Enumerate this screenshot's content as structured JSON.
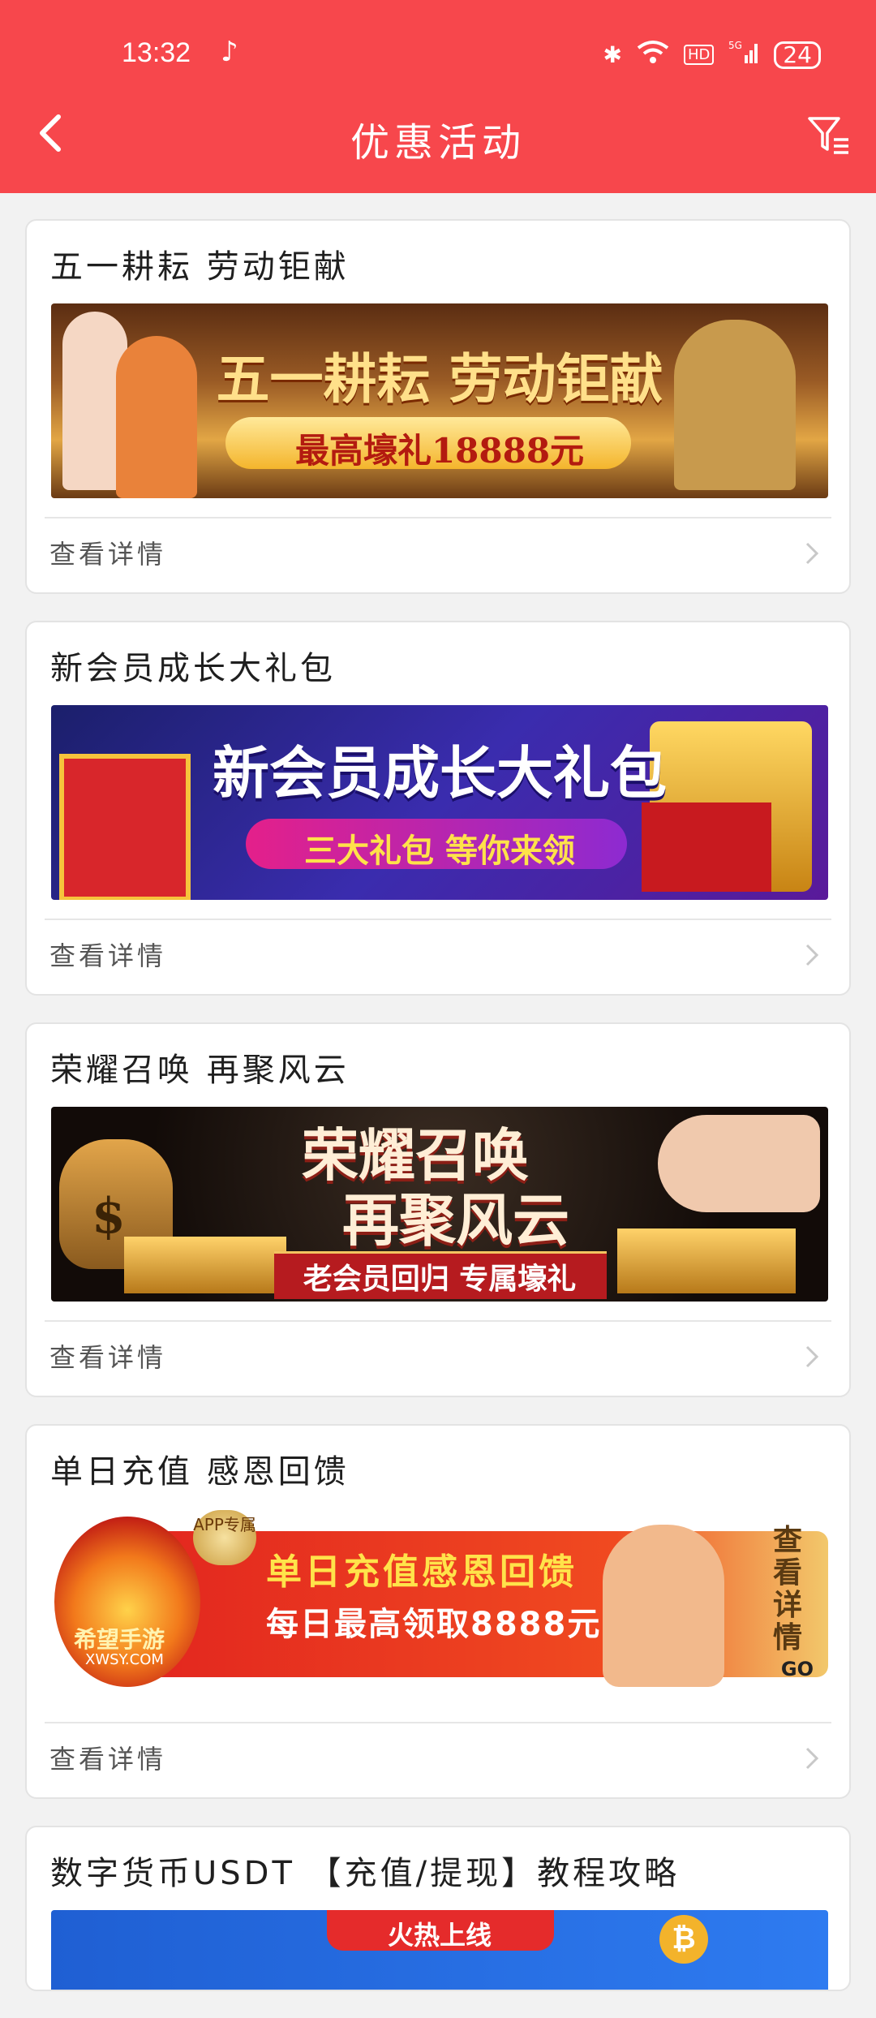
{
  "status_bar": {
    "time": "13:32",
    "battery": "24"
  },
  "header": {
    "title": "优惠活动"
  },
  "cards": [
    {
      "title": "五一耕耘 劳动钜献",
      "banner_line1": "五一耕耘 劳动钜献",
      "banner_line2": "最高壕礼18888元",
      "detail": "查看详情"
    },
    {
      "title": "新会员成长大礼包",
      "banner_line1": "新会员成长大礼包",
      "banner_line2": "三大礼包 等你来领",
      "detail": "查看详情"
    },
    {
      "title": "荣耀召唤 再聚风云",
      "banner_line1": "荣耀召唤",
      "banner_line1b": "再聚风云",
      "banner_line2": "老会员回归 专属壕礼",
      "detail": "查看详情"
    },
    {
      "title": "单日充值 感恩回馈",
      "banner_badge": "APP专属",
      "banner_logo": "希望手游",
      "banner_logo_sub": "XWSY.COM",
      "banner_line1": "单日充值感恩回馈",
      "banner_line2": "每日最高领取8888元",
      "banner_side": "查看详情",
      "banner_go": "GO",
      "detail": "查看详情"
    },
    {
      "title": "数字货币USDT 【充值/提现】教程攻略",
      "banner_line1": "火热上线"
    }
  ],
  "colors": {
    "header_bg": "#f7474c",
    "page_bg": "#f2f2f2"
  }
}
